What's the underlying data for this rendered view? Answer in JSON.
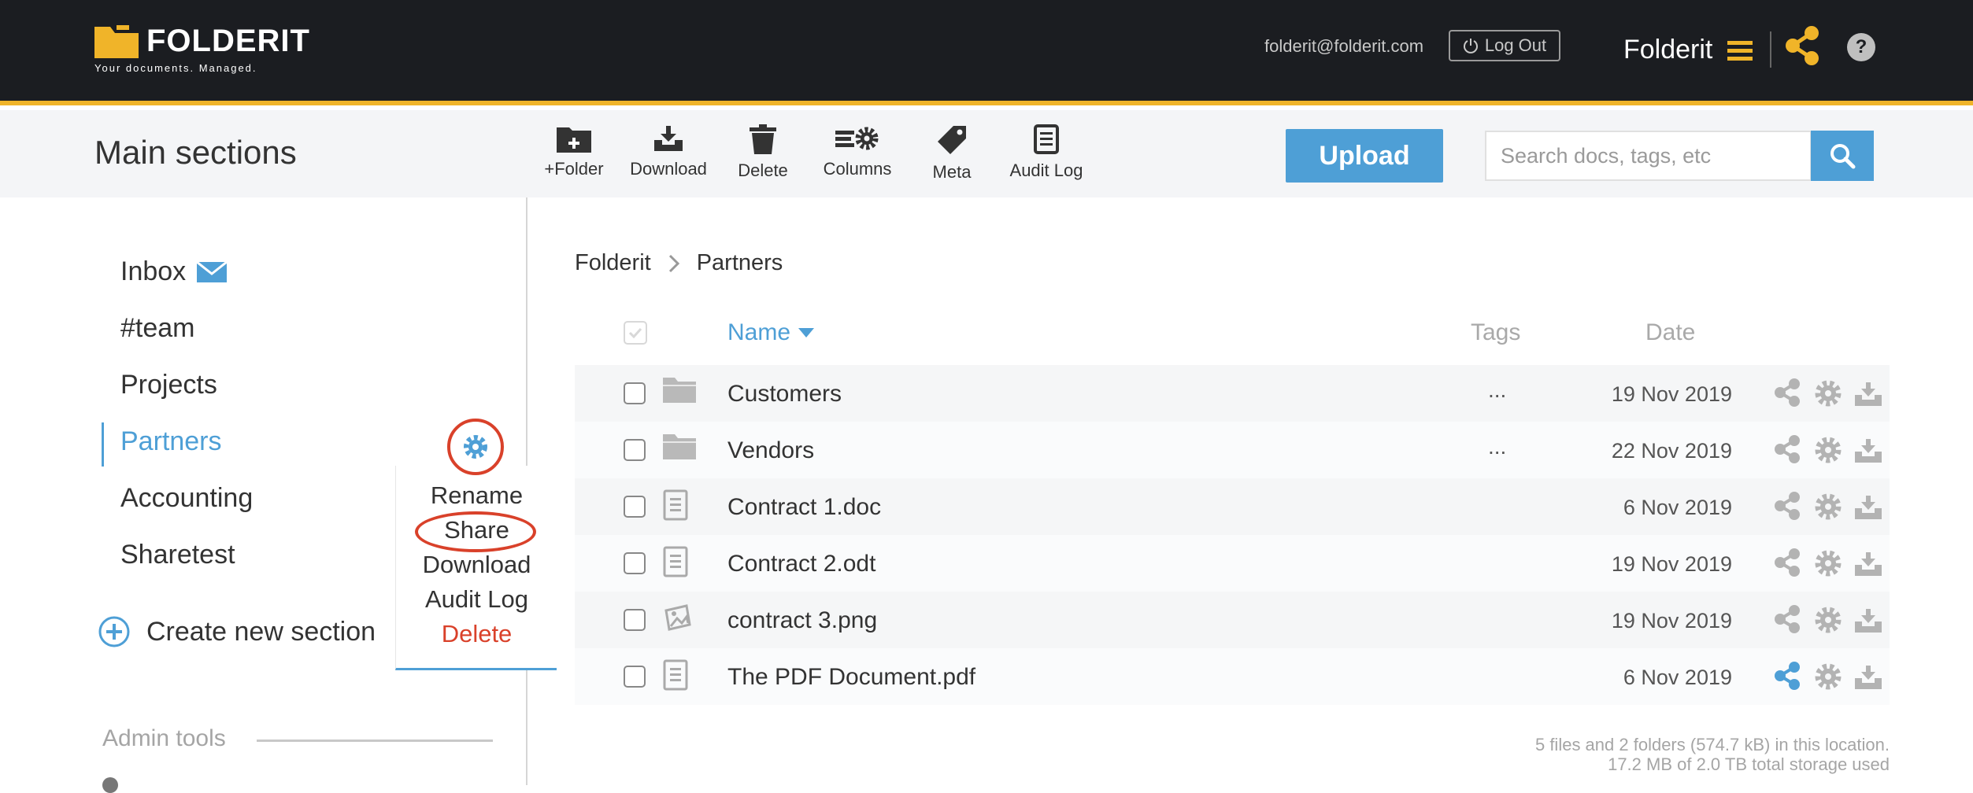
{
  "brand": {
    "name": "FOLDERIT",
    "tagline": "Your documents. Managed.",
    "accent": "#f0b429",
    "blue": "#4e9fd6"
  },
  "header": {
    "email": "folderit@folderit.com",
    "logout_label": "Log Out",
    "account_name": "Folderit",
    "help_label": "?"
  },
  "toolbar": {
    "section_title": "Main sections",
    "tools": [
      {
        "label": "+Folder",
        "icon": "folder-plus-icon"
      },
      {
        "label": "Download",
        "icon": "download-tray-icon"
      },
      {
        "label": "Delete",
        "icon": "trash-icon"
      },
      {
        "label": "Columns",
        "icon": "columns-gear-icon"
      },
      {
        "label": "Meta",
        "icon": "tag-icon"
      },
      {
        "label": "Audit Log",
        "icon": "document-list-icon"
      }
    ],
    "upload_label": "Upload",
    "search_placeholder": "Search docs, tags, etc"
  },
  "sidebar": {
    "items": [
      {
        "label": "Inbox"
      },
      {
        "label": "#team"
      },
      {
        "label": "Projects"
      },
      {
        "label": "Partners",
        "active": true
      },
      {
        "label": "Accounting"
      },
      {
        "label": "Sharetest"
      }
    ],
    "create_label": "Create new section",
    "admin_label": "Admin tools"
  },
  "context_menu": {
    "items": [
      {
        "label": "Rename"
      },
      {
        "label": "Share",
        "highlighted": true
      },
      {
        "label": "Download"
      },
      {
        "label": "Audit Log"
      },
      {
        "label": "Delete",
        "danger": true
      }
    ]
  },
  "breadcrumb": {
    "root": "Folderit",
    "current": "Partners"
  },
  "table": {
    "headers": {
      "name": "Name",
      "tags": "Tags",
      "date": "Date"
    },
    "rows": [
      {
        "type": "folder",
        "name": "Customers",
        "tags": "...",
        "date": "19 Nov 2019",
        "shared": false
      },
      {
        "type": "folder",
        "name": "Vendors",
        "tags": "...",
        "date": "22 Nov 2019",
        "shared": false
      },
      {
        "type": "document",
        "name": "Contract 1.doc",
        "tags": "",
        "date": "6 Nov 2019",
        "shared": false
      },
      {
        "type": "document",
        "name": "Contract 2.odt",
        "tags": "",
        "date": "19 Nov 2019",
        "shared": false
      },
      {
        "type": "image",
        "name": "contract 3.png",
        "tags": "",
        "date": "19 Nov 2019",
        "shared": false
      },
      {
        "type": "document",
        "name": "The PDF Document.pdf",
        "tags": "",
        "date": "6 Nov 2019",
        "shared": true
      }
    ]
  },
  "footer": {
    "location_info": "5 files and 2 folders (574.7 kB) in this location.",
    "storage_info": "17.2 MB of 2.0 TB total storage used"
  }
}
